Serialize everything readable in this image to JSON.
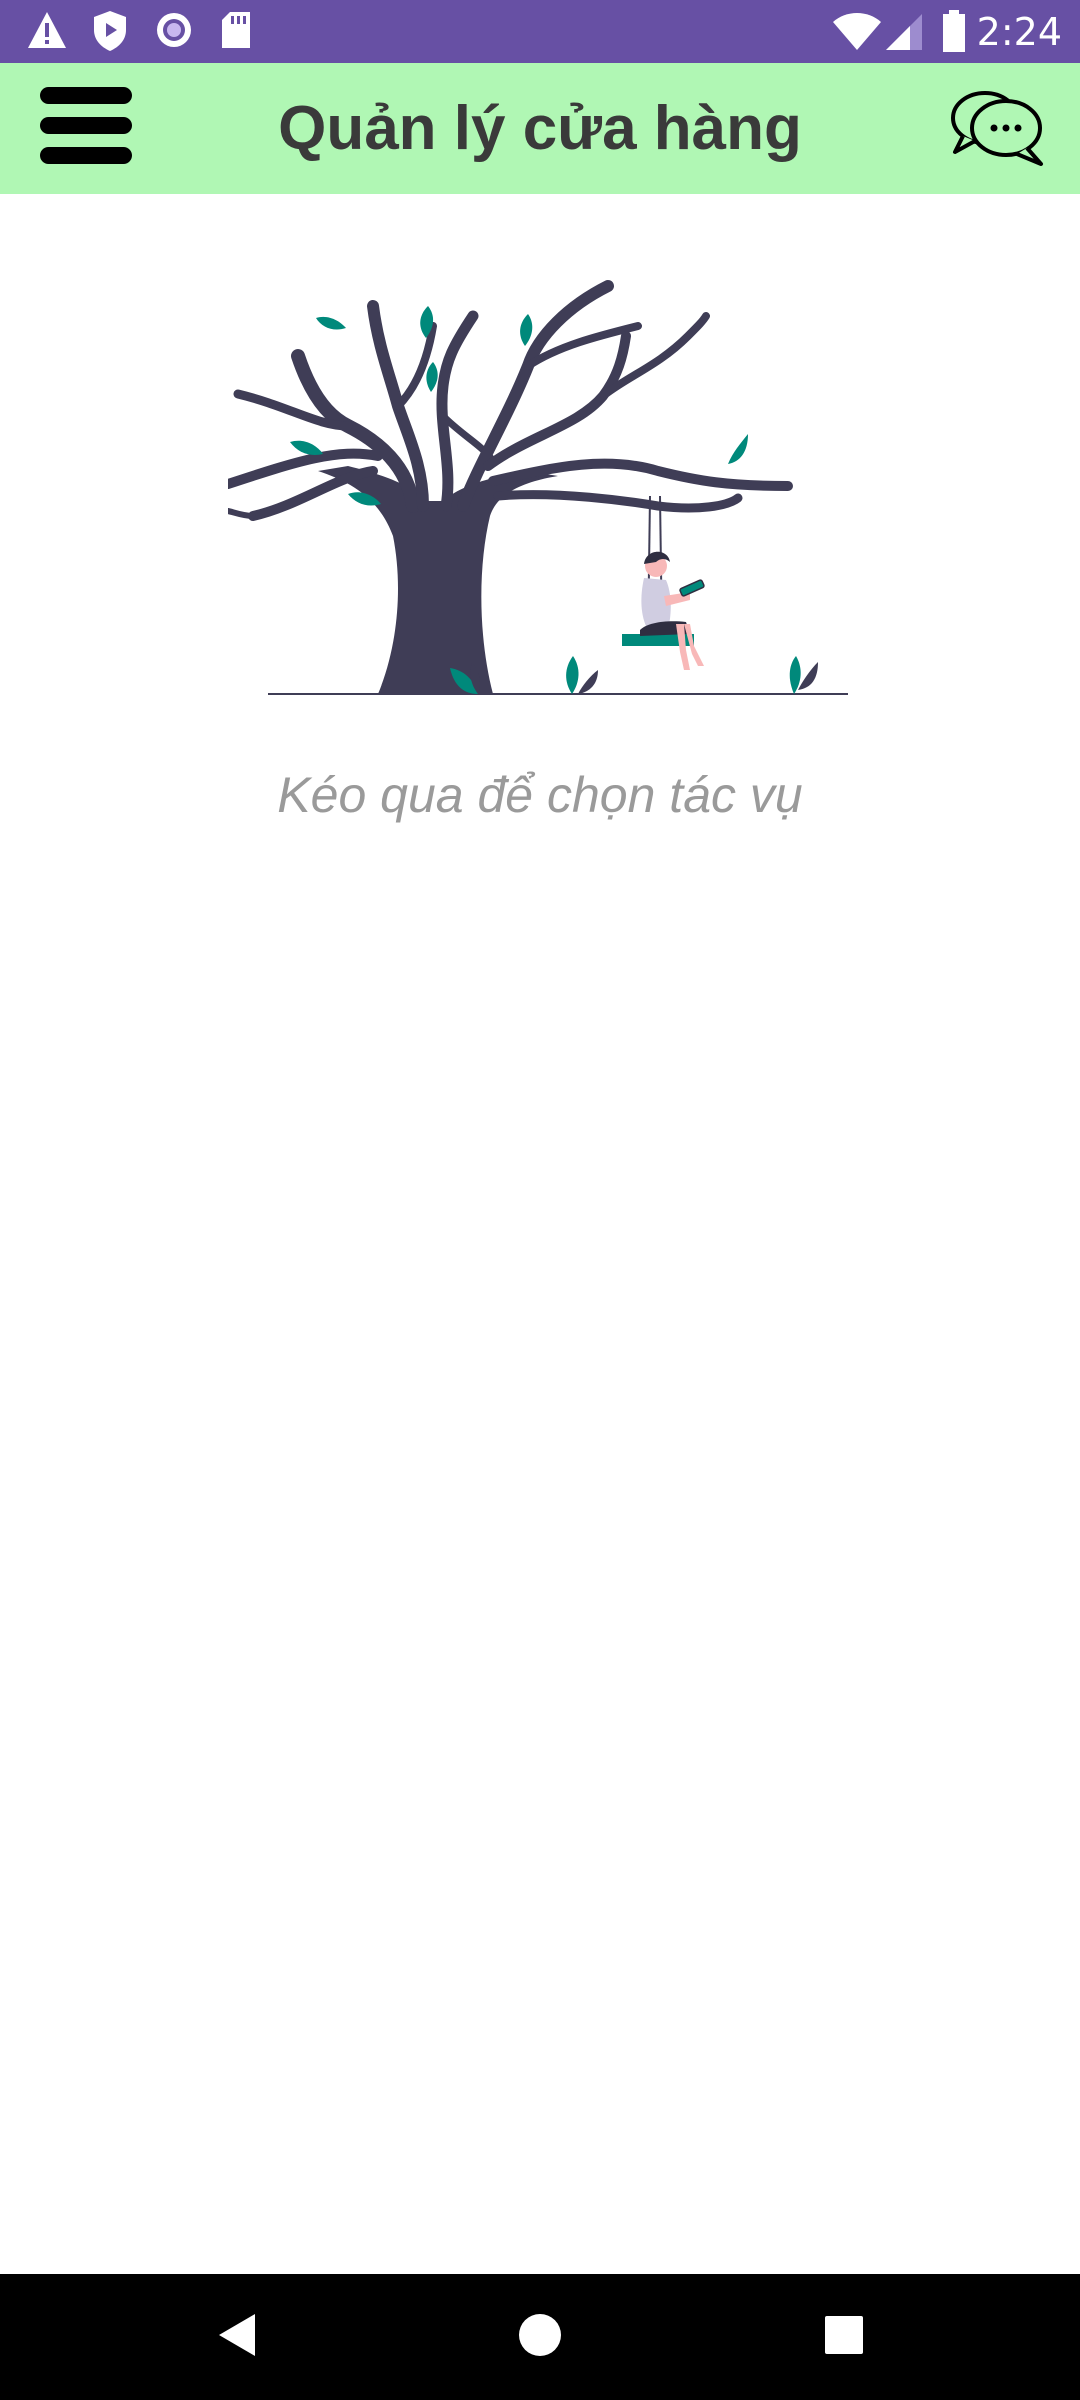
{
  "status_bar": {
    "time": "2:24",
    "left_icons": [
      "warning-icon",
      "shield-play-icon",
      "record-icon",
      "sd-card-icon"
    ],
    "right_icons": [
      "wifi-icon",
      "cell-signal-icon",
      "battery-icon"
    ],
    "background": "#6750a4"
  },
  "app_bar": {
    "title": "Quản lý cửa hàng",
    "left_icon": "menu-icon",
    "right_icon": "chat-icon",
    "background": "#b0f7b4"
  },
  "main": {
    "illustration": "tree-swing-illustration",
    "hint": "Kéo qua để chọn tác vụ",
    "accent_color": "#00897b",
    "tree_color": "#3f3d56"
  },
  "nav_bar": {
    "buttons": [
      "back-icon",
      "home-icon",
      "recents-icon"
    ],
    "background": "#000000"
  }
}
